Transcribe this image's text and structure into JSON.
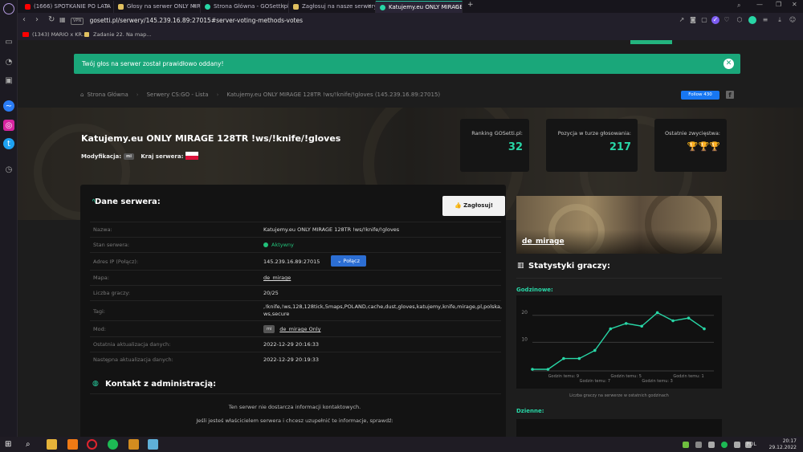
{
  "browser": {
    "tabs": [
      {
        "label": "(1666) SPOTKANIE PO LATA",
        "fav_color": "#ff0000"
      },
      {
        "label": "Głosy na serwer ONLY MIR",
        "fav_color": "#e0c060"
      },
      {
        "label": "Strona Główna - GOSetti.pl",
        "fav_color": "#28d6a6"
      },
      {
        "label": "Zagłosuj na nasze serwery!",
        "fav_color": "#e0c060"
      },
      {
        "label": "Katujemy.eu ONLY MIRAGE",
        "fav_color": "#28d6a6"
      }
    ],
    "new_tab": "+",
    "vpn_label": "VPN",
    "url": "gosetti.pl/serwery/145.239.16.89:27015#server-voting-methods-votes",
    "bookmarks": [
      "(1343) MARIO x KR...",
      "Zadanie 22. Na map..."
    ]
  },
  "alert": {
    "text": "Twój głos na serwer został prawidłowo oddany!",
    "close": "✕"
  },
  "breadcrumb": [
    "Strona Główna",
    "Serwery CS:GO - Lista",
    "Katujemy.eu ONLY MIRAGE 128TR !ws/!knife/!gloves (145.239.16.89:27015)"
  ],
  "facebook": {
    "follow_label": "Follow 430",
    "icon": "f"
  },
  "server": {
    "title": "Katujemy.eu ONLY MIRAGE 128TR !ws/!knife/!gloves",
    "mod_label": "Modyfikacja:",
    "mod_chip": "mi",
    "country_label": "Kraj serwera:"
  },
  "stats": [
    {
      "label": "Ranking GOSetti.pl:",
      "value": "32"
    },
    {
      "label": "Pozycja w turze głosowania:",
      "value": "217"
    },
    {
      "label": "Ostatnie zwycięstwa:",
      "value": "🏆🏆🏆"
    }
  ],
  "details": {
    "title": "Dane serwera:",
    "vote_button": "Zagłosuj!",
    "rows": [
      {
        "label": "Nazwa:",
        "value": "Katujemy.eu ONLY MIRAGE 128TR !ws/!knife/!gloves"
      },
      {
        "label": "Stan serwera:",
        "value": "Aktywny"
      },
      {
        "label": "Adres IP (Połącz):",
        "value": "145.239.16.89:27015"
      },
      {
        "label": "Mapa:",
        "value": "de_mirage"
      },
      {
        "label": "Liczba graczy:",
        "value": "20/25"
      },
      {
        "label": "Tagi:",
        "value": ",!knife,!ws,128,128tick,5maps,POLAND,cache,dust,gloves,katujemy,knife,mirage,pl,polska,ws,secure"
      },
      {
        "label": "Mod:",
        "value": "de_mirage Only"
      },
      {
        "label": "Ostatnia aktualizacja danych:",
        "value": "2022-12-29 20:16:33"
      },
      {
        "label": "Następna aktualizacja danych:",
        "value": "2022-12-29 20:19:33"
      }
    ],
    "connect_button": "Połącz",
    "mod_chip": "mi"
  },
  "contact": {
    "title": "Kontakt z administracją:",
    "line1": "Ten serwer nie dostarcza informacji kontaktowych.",
    "line2": "Jeśli jesteś właścicielem serwera i chcesz uzupełnić te informacje, sprawdź:"
  },
  "map": {
    "name": "de_mirage"
  },
  "player_stats": {
    "title": "Statystyki graczy:",
    "hourly_label": "Godzinowe:",
    "daily_label": "Dzienne:",
    "caption": "Liczba graczy na serwerze w ostatnich godzinach"
  },
  "chart_data": {
    "type": "line",
    "x": [
      0,
      1,
      2,
      3,
      4,
      5,
      6,
      7,
      8,
      9,
      10,
      11
    ],
    "values": [
      0,
      0,
      4,
      4,
      7,
      15,
      17,
      16,
      21,
      18,
      19,
      15
    ],
    "ylim": [
      0,
      25
    ],
    "yticks": [
      "10",
      "20"
    ],
    "xtick_labels": [
      "Godzin temu: 9",
      "Godzin temu: 7",
      "Godzin temu: 5",
      "Godzin temu: 3",
      "Godzin temu: 1"
    ],
    "line_color": "#28d6a6",
    "grid": true
  },
  "taskbar": {
    "lang": "POL",
    "time": "20:17",
    "date": "29.12.2022"
  },
  "colors": {
    "accent": "#28d6a6",
    "alert": "#1aa77a",
    "connect": "#2c6ed3"
  }
}
